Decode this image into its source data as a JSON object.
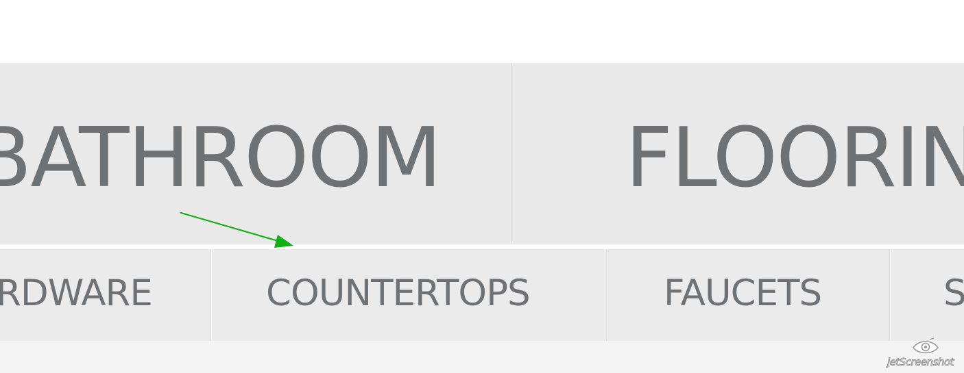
{
  "main_nav": {
    "items": [
      {
        "label": "BATHROOM"
      },
      {
        "label": "FLOORING"
      }
    ]
  },
  "sub_nav": {
    "items": [
      {
        "label": "HARDWARE"
      },
      {
        "label": "COUNTERTOPS"
      },
      {
        "label": "FAUCETS"
      },
      {
        "label": "SINKS"
      }
    ]
  },
  "annotation": {
    "icon": "arrow-icon",
    "color": "#12b012"
  },
  "watermark": {
    "text": "jetScreenshot",
    "icon": "eye-logo-icon"
  },
  "colors": {
    "nav_background": "#e9e9e9",
    "nav_text": "#6f7275",
    "divider": "#d6d6d6"
  }
}
